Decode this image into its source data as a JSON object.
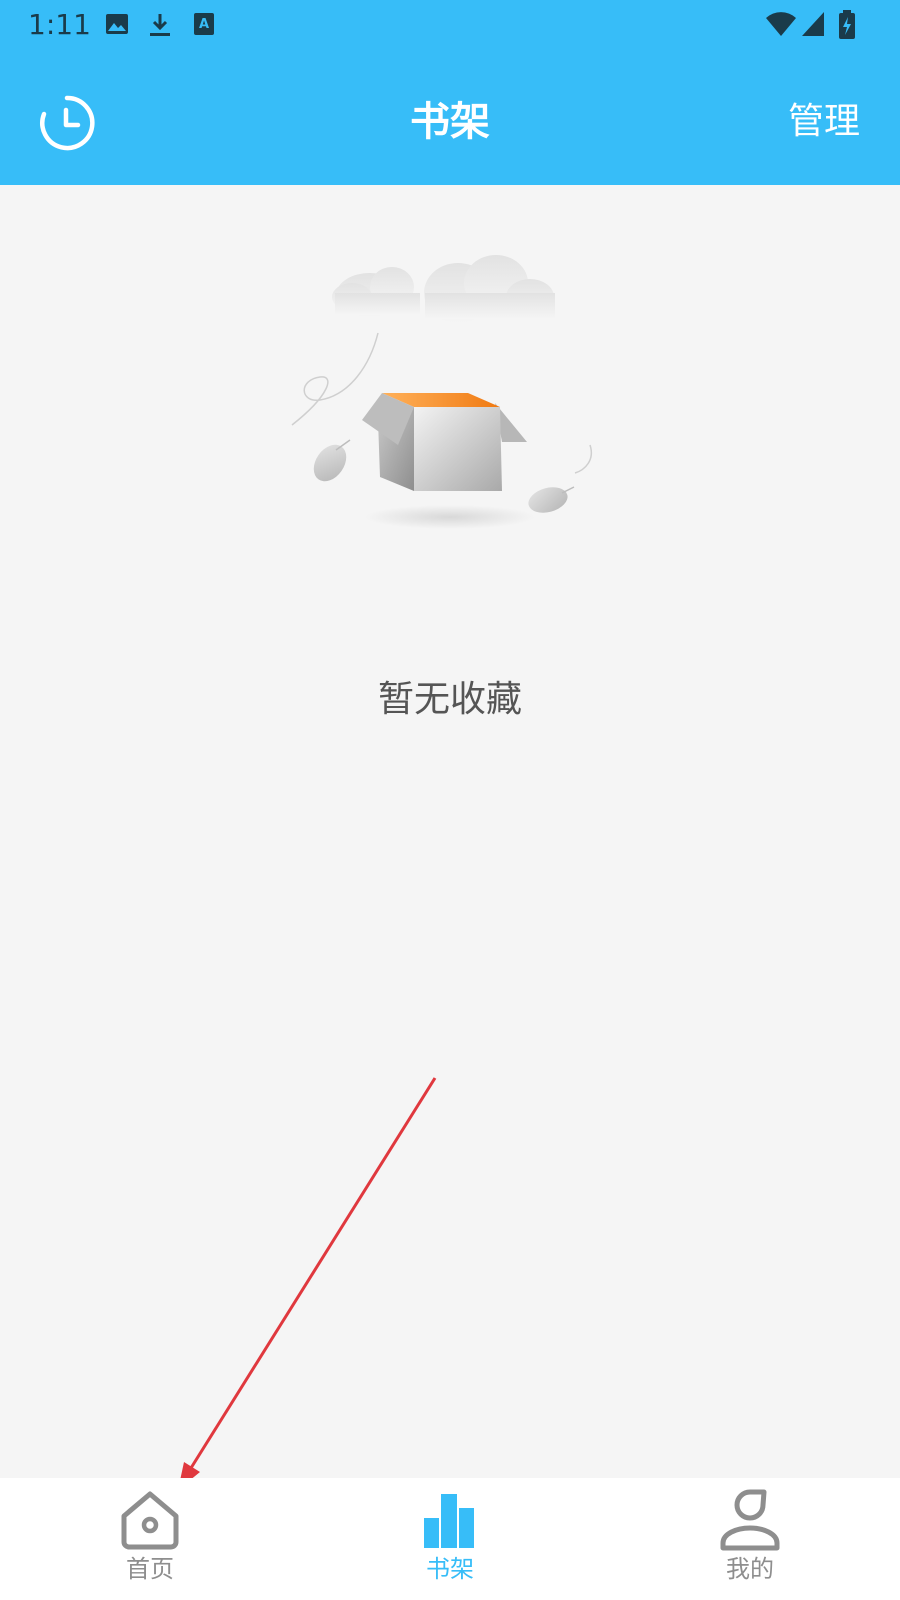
{
  "colors": {
    "header_bg": "#37bdf8",
    "active_tab": "#37bdf8",
    "inactive_tab": "#8e8e8e",
    "annotation_arrow": "#e0383e"
  },
  "status_bar": {
    "time": "1:11",
    "left_icons": [
      "image-icon",
      "download-icon",
      "text-a-icon"
    ],
    "right_icons": [
      "wifi-icon",
      "signal-icon",
      "battery-charging-icon"
    ]
  },
  "header": {
    "history_icon": "clock-icon",
    "title": "书架",
    "manage_label": "管理"
  },
  "empty_state": {
    "illustration": "empty-box-illustration",
    "text": "暂无收藏"
  },
  "bottom_nav": {
    "items": [
      {
        "label": "首页",
        "icon": "home-icon",
        "active": false
      },
      {
        "label": "书架",
        "icon": "bookshelf-icon",
        "active": true
      },
      {
        "label": "我的",
        "icon": "profile-icon",
        "active": false
      }
    ]
  }
}
